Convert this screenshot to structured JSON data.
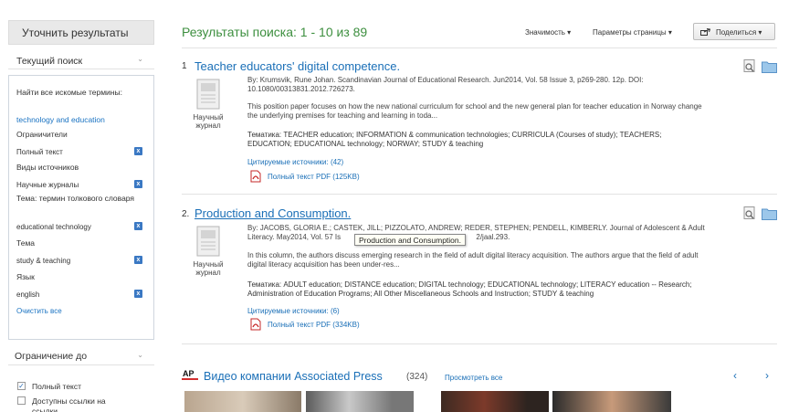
{
  "sidebar": {
    "refine_title": "Уточнить результаты",
    "current_search": {
      "header": "Текущий поиск",
      "find_all_label": "Найти все искомые термины:",
      "query": "technology and education",
      "limiters_label": "Ограничители",
      "full_text": "Полный текст",
      "source_types_label": "Виды источников",
      "source_type": "Научные журналы",
      "thesaurus_label": "Тема: термин толкового словаря",
      "thesaurus_term": "educational technology",
      "subject_label": "Тема",
      "subject_term": "study & teaching",
      "language_label": "Язык",
      "language_term": "english",
      "clear_all": "Очистить все",
      "remove_icon": "x"
    },
    "limit_to": {
      "header": "Ограничение до",
      "options": [
        {
          "label": "Полный текст",
          "checked": true
        },
        {
          "label": "Доступны ссылки на",
          "checked": false
        }
      ],
      "third_line": "ссылки"
    }
  },
  "main": {
    "results_title": "Результаты поиска: 1 - 10 из 89",
    "relevance": "Значимость ▾",
    "page_options": "Параметры страницы ▾",
    "share": "Поделиться ▾",
    "results": [
      {
        "num": "1",
        "title": "Teacher educators' digital competence.",
        "byline": "By: Krumsvik, Rune Johan. Scandinavian Journal of Educational Research. Jun2014, Vol. 58 Issue 3, p269-280. 12p. DOI:",
        "doi": "10.1080/00313831.2012.726273.",
        "abstract_1": "This position paper focuses on how the new national curriculum for school and the new general plan for teacher education in Norway change",
        "abstract_2": "the underlying premises for teaching and learning in toda...",
        "subjects_1": "Тематика: TEACHER education; INFORMATION & communication technologies; CURRICULA (Courses of study); TEACHERS;",
        "subjects_2": "EDUCATION; EDUCATIONAL technology; NORWAY; STUDY & teaching",
        "cited": "Цитируемые источники: (42)",
        "pdf": "Полный текст PDF (125KB)",
        "pub_type": "Научный журнал"
      },
      {
        "num": "2.",
        "title": "Production and Consumption.",
        "byline": "By: JACOBS, GLORIA E.; CASTEK, JILL; PIZZOLATO, ANDREW; REDER, STEPHEN; PENDELL, KIMBERLY. Journal of Adolescent & Adult",
        "byline_2": "Literacy. May2014, Vol. 57 Is",
        "byline_2_tail": "2/jaal.293.",
        "abstract_1": "In this column, the authors discuss emerging research in the field of adult digital literacy acquisition. The authors argue that the field of adult",
        "abstract_2": "digital literacy acquisition has been under-res...",
        "subjects_1": "Тематика: ADULT education; DISTANCE education; DIGITAL technology; EDUCATIONAL technology; LITERACY education -- Research;",
        "subjects_2": "Administration of Education Programs; All Other Miscellaneous Schools and Instruction; STUDY & teaching",
        "cited": "Цитируемые источники: (6)",
        "pdf": "Полный текст PDF (334KB)",
        "pub_type": "Научный журнал"
      }
    ],
    "tooltip": "Production and Consumption."
  },
  "video": {
    "logo": "AP",
    "title": "Видео компании Associated Press",
    "count": "(324)",
    "browse": "Просмотреть все",
    "prev": "‹",
    "next": "›"
  },
  "colors": {
    "accent_blue": "#1a6fb7",
    "results_green": "#3d8f3f",
    "remove_blue": "#3a78c3"
  }
}
